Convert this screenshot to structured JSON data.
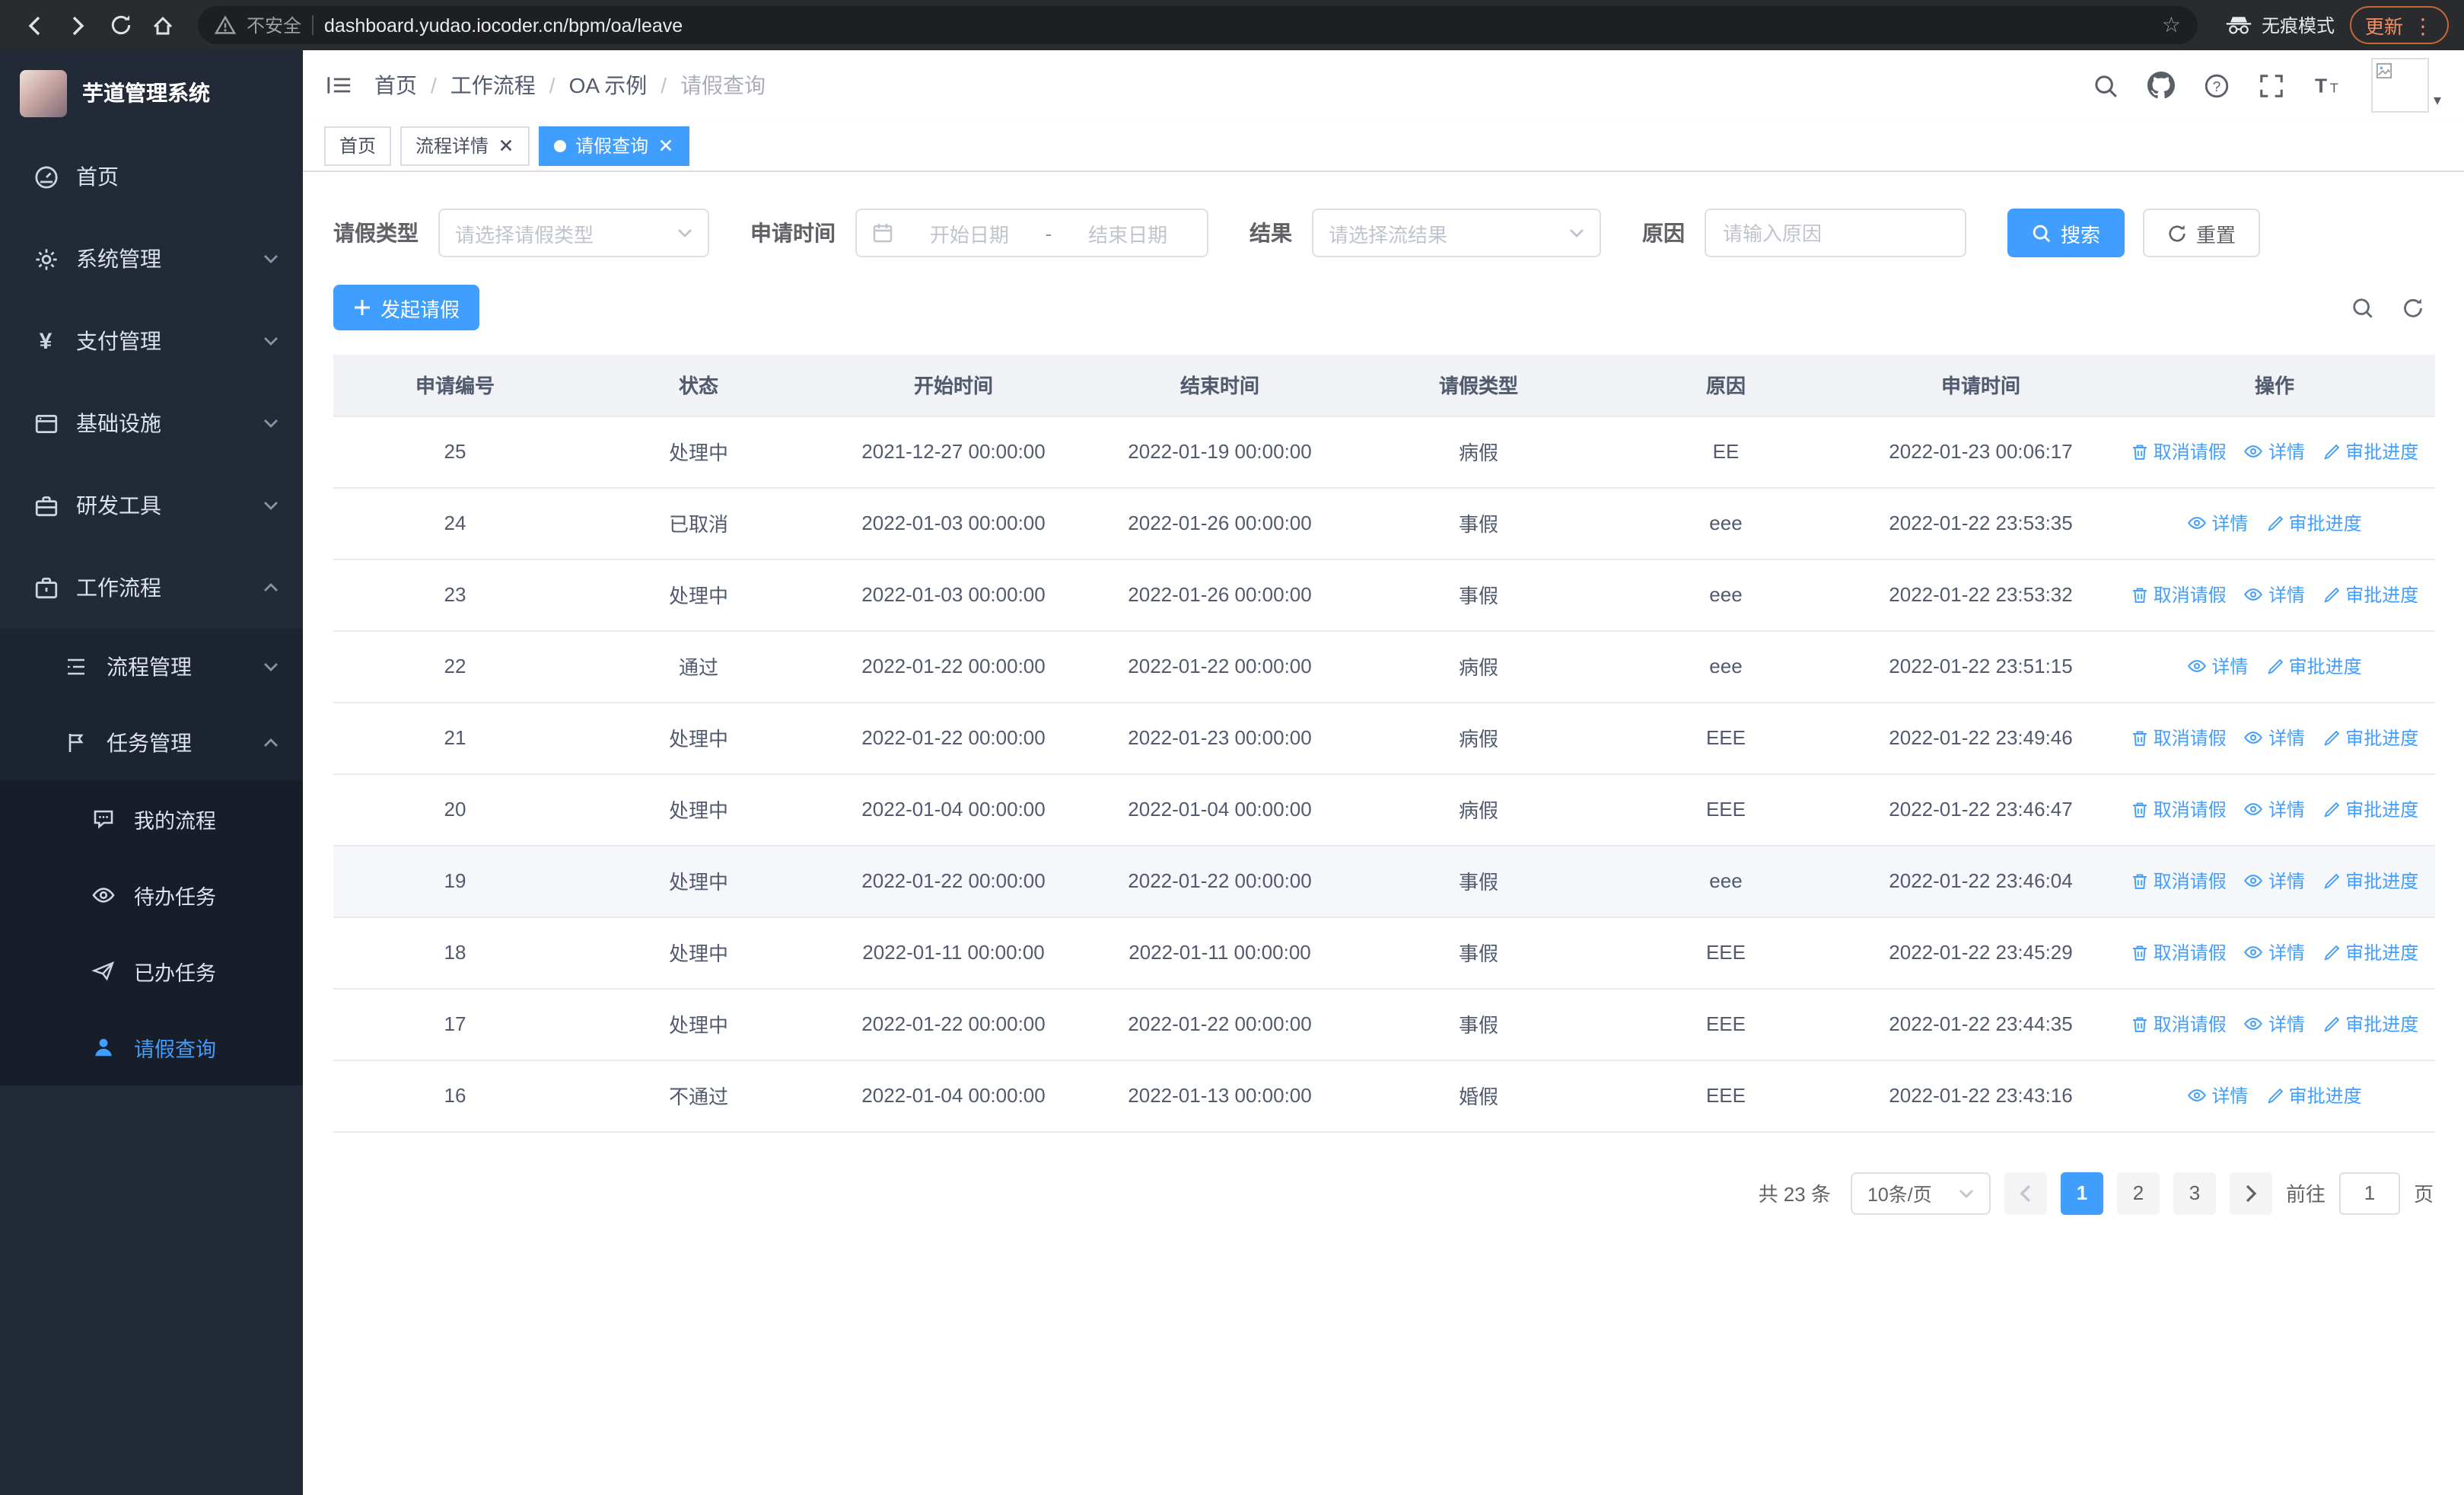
{
  "colors": {
    "primary": "#409eff"
  },
  "browser": {
    "security_label": "不安全",
    "url": "dashboard.yudao.iocoder.cn/bpm/oa/leave",
    "incognito_label": "无痕模式",
    "update_label": "更新"
  },
  "sidebar": {
    "logo_title": "芋道管理系统",
    "items": [
      {
        "label": "首页"
      },
      {
        "label": "系统管理"
      },
      {
        "label": "支付管理"
      },
      {
        "label": "基础设施"
      },
      {
        "label": "研发工具"
      },
      {
        "label": "工作流程"
      }
    ],
    "workflow_children": [
      {
        "label": "流程管理"
      },
      {
        "label": "任务管理"
      }
    ],
    "task_children": [
      {
        "label": "我的流程"
      },
      {
        "label": "待办任务"
      },
      {
        "label": "已办任务"
      },
      {
        "label": "请假查询"
      }
    ]
  },
  "header": {
    "breadcrumb": [
      "首页",
      "工作流程",
      "OA 示例",
      "请假查询"
    ]
  },
  "tabs": [
    {
      "label": "首页"
    },
    {
      "label": "流程详情"
    },
    {
      "label": "请假查询"
    }
  ],
  "filters": {
    "leave_type_label": "请假类型",
    "leave_type_placeholder": "请选择请假类型",
    "apply_time_label": "申请时间",
    "start_date_placeholder": "开始日期",
    "range_separator": "-",
    "end_date_placeholder": "结束日期",
    "result_label": "结果",
    "result_placeholder": "请选择流结果",
    "reason_label": "原因",
    "reason_placeholder": "请输入原因",
    "search_button": "搜索",
    "reset_button": "重置"
  },
  "toolbar": {
    "create_button": "发起请假"
  },
  "table": {
    "columns": [
      "申请编号",
      "状态",
      "开始时间",
      "结束时间",
      "请假类型",
      "原因",
      "申请时间",
      "操作"
    ],
    "actions": {
      "cancel": "取消请假",
      "detail": "详情",
      "progress": "审批进度"
    },
    "rows": [
      {
        "id": "25",
        "status": "处理中",
        "start": "2021-12-27 00:00:00",
        "end": "2022-01-19 00:00:00",
        "type": "病假",
        "reason": "EE",
        "apply_time": "2022-01-23 00:06:17",
        "cancellable": true,
        "hover": false
      },
      {
        "id": "24",
        "status": "已取消",
        "start": "2022-01-03 00:00:00",
        "end": "2022-01-26 00:00:00",
        "type": "事假",
        "reason": "eee",
        "apply_time": "2022-01-22 23:53:35",
        "cancellable": false,
        "hover": false
      },
      {
        "id": "23",
        "status": "处理中",
        "start": "2022-01-03 00:00:00",
        "end": "2022-01-26 00:00:00",
        "type": "事假",
        "reason": "eee",
        "apply_time": "2022-01-22 23:53:32",
        "cancellable": true,
        "hover": false
      },
      {
        "id": "22",
        "status": "通过",
        "start": "2022-01-22 00:00:00",
        "end": "2022-01-22 00:00:00",
        "type": "病假",
        "reason": "eee",
        "apply_time": "2022-01-22 23:51:15",
        "cancellable": false,
        "hover": false
      },
      {
        "id": "21",
        "status": "处理中",
        "start": "2022-01-22 00:00:00",
        "end": "2022-01-23 00:00:00",
        "type": "病假",
        "reason": "EEE",
        "apply_time": "2022-01-22 23:49:46",
        "cancellable": true,
        "hover": false
      },
      {
        "id": "20",
        "status": "处理中",
        "start": "2022-01-04 00:00:00",
        "end": "2022-01-04 00:00:00",
        "type": "病假",
        "reason": "EEE",
        "apply_time": "2022-01-22 23:46:47",
        "cancellable": true,
        "hover": false
      },
      {
        "id": "19",
        "status": "处理中",
        "start": "2022-01-22 00:00:00",
        "end": "2022-01-22 00:00:00",
        "type": "事假",
        "reason": "eee",
        "apply_time": "2022-01-22 23:46:04",
        "cancellable": true,
        "hover": true
      },
      {
        "id": "18",
        "status": "处理中",
        "start": "2022-01-11 00:00:00",
        "end": "2022-01-11 00:00:00",
        "type": "事假",
        "reason": "EEE",
        "apply_time": "2022-01-22 23:45:29",
        "cancellable": true,
        "hover": false
      },
      {
        "id": "17",
        "status": "处理中",
        "start": "2022-01-22 00:00:00",
        "end": "2022-01-22 00:00:00",
        "type": "事假",
        "reason": "EEE",
        "apply_time": "2022-01-22 23:44:35",
        "cancellable": true,
        "hover": false
      },
      {
        "id": "16",
        "status": "不通过",
        "start": "2022-01-04 00:00:00",
        "end": "2022-01-13 00:00:00",
        "type": "婚假",
        "reason": "EEE",
        "apply_time": "2022-01-22 23:43:16",
        "cancellable": false,
        "hover": false
      }
    ]
  },
  "pagination": {
    "total_text": "共 23 条",
    "page_size": "10条/页",
    "pages": [
      "1",
      "2",
      "3"
    ],
    "active_page": "1",
    "goto_label": "前往",
    "goto_value": "1",
    "goto_suffix": "页"
  }
}
